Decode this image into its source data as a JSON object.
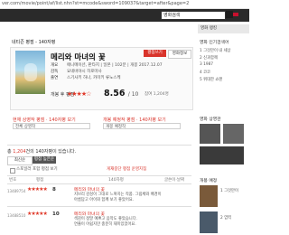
{
  "browser": {
    "url": "ver.com/movie/point/af/list.nhn?st=mcode&sword=109037&target=after&page=2"
  },
  "header": {
    "search_placeholder": "영화검색"
  },
  "section_title": "네티즌 평점 - 140자평",
  "movie": {
    "title": "메리와 마녀의 꽃",
    "rate_button": "평점쓰기",
    "detail_button": "영화정보",
    "info_rows": [
      {
        "key": "개요",
        "value": "애니메이션, 판타지 | 일본 | 102분 | 개봉 2017.12.07"
      },
      {
        "key": "감독",
        "value": "요네바야시 히로마사"
      },
      {
        "key": "출연",
        "value": "스기사키 하나, 카미키 류노스케"
      }
    ],
    "rating_label": "개봉 후 평점",
    "stars": "★★★★☆",
    "score": "8.56",
    "score_max": "/ 10",
    "count": "참여 1,204명"
  },
  "filters": {
    "left_head": "현재 상영작 평점 · 140자평 보기",
    "left_value": "전체 상영작",
    "right_head": "개봉 예정작 평점 · 140자평 보기",
    "right_value": "개봉 예정작"
  },
  "list": {
    "summary_prefix": "총 ",
    "summary_count": "1,204",
    "summary_suffix": "건의 140자평이 있습니다.",
    "tabs": [
      "최신순",
      "평점 높은순"
    ],
    "checkbox_label": "스포일러 포함 평점 보기",
    "checkbox_link": "게재중단 평점 운영지침",
    "col_heads": [
      "번호",
      "평점",
      "140자평",
      "글쓴이·날짜"
    ],
    "reviews": [
      {
        "id": "13489754",
        "stars": "★★★★★",
        "score": "8",
        "title": "메리와 마녀의 꽃",
        "body": [
          "지브리 감성이 그대로 느껴지는 작품. 그림체와 배경이",
          "아름답고 아이와 함께 보기 좋았어요."
        ]
      },
      {
        "id": "13488510",
        "stars": "★★★★★",
        "score": "10",
        "title": "메리와 마녀의 꽃",
        "body": [
          "색감이 정말 예쁘고 음악도 좋았습니다.",
          "연출이 아쉽지만 충분히 재미있었어요."
        ]
      }
    ]
  },
  "sidebar": {
    "header": "영화 랭킹",
    "block1_title": "영화 인기검색어",
    "block1_items": [
      "1 그것만이 내 세상",
      "2 신과함께",
      "3 1987",
      "4 코코",
      "5 위대한 쇼맨"
    ],
    "block2_title": "영화 상영관",
    "block3_title": "개봉 예정",
    "block3_items": [
      "1 그것만이",
      "2 염력"
    ]
  },
  "colors": {
    "accent": "#d9342b",
    "star": "#e03a2a",
    "topbar": "#2a2a2a"
  }
}
